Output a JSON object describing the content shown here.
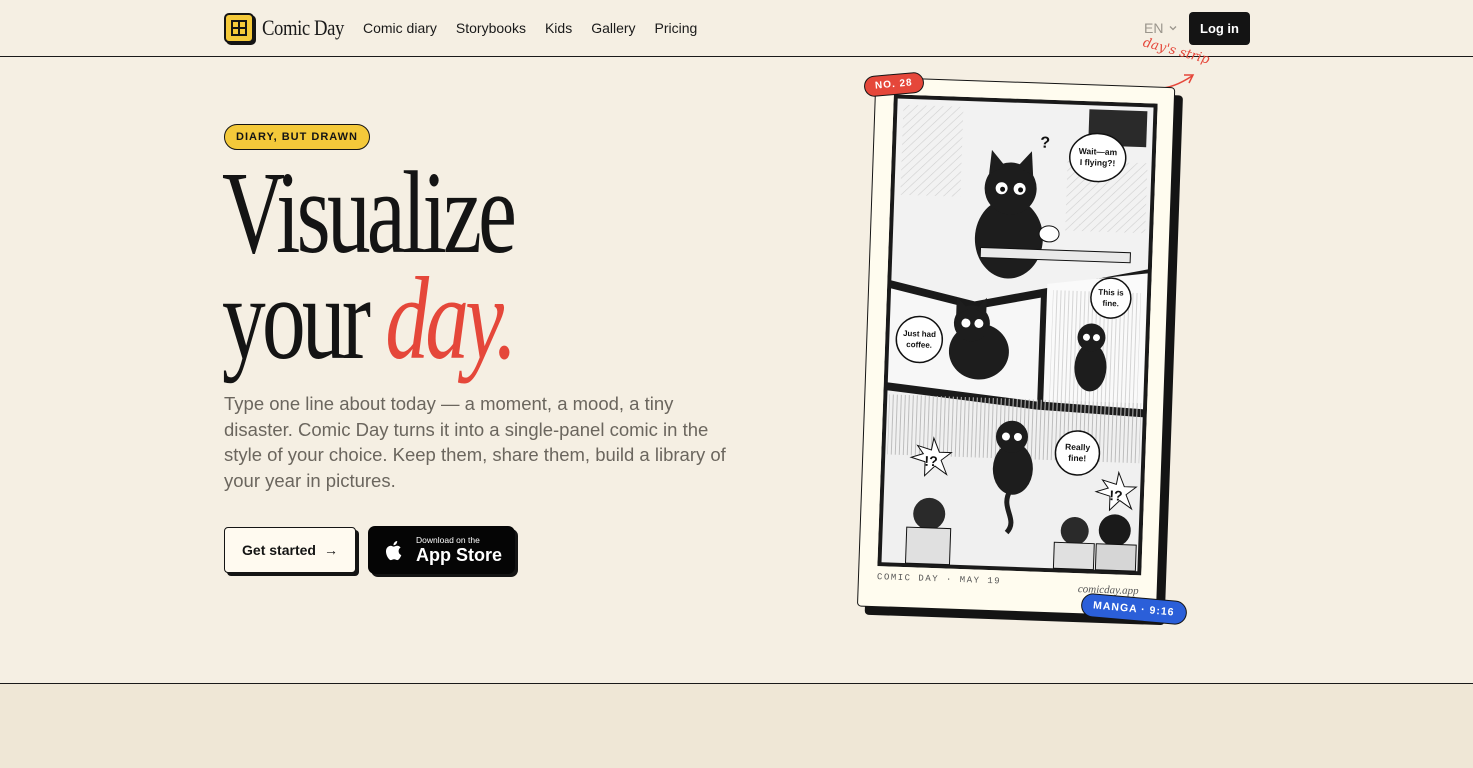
{
  "nav": {
    "brand": "Comic Day",
    "links": [
      "Comic diary",
      "Storybooks",
      "Kids",
      "Gallery",
      "Pricing"
    ],
    "language": "EN",
    "login_label": "Log in"
  },
  "hero": {
    "badge": "DIARY, BUT DRAWN",
    "title_line1": "Visualize",
    "title_line2_plain": "your",
    "title_line2_accent": "day.",
    "lede": "Type one line about today — a moment, a mood, a tiny disaster. Comic Day turns it into a single-panel comic in the style of your choice. Keep them, share them, build a library of your year in pictures.",
    "cta_primary": "Get started",
    "cta_primary_arrow": "→",
    "app_store_small": "Download on the",
    "app_store_big": "App Store"
  },
  "comic_card": {
    "number_tag": "NO. 28",
    "style_tag": "MANGA · 9:16",
    "footer_left": "COMIC DAY · MAY 19",
    "footer_right": "comicday.app",
    "scribble": "day's strip",
    "bubbles": [
      "Wait—am I flying?!",
      "This is fine.",
      "Just had coffee.",
      "Really fine!",
      "!?",
      "!?"
    ]
  },
  "colors": {
    "background": "#f5efe3",
    "ink": "#141414",
    "accent_red": "#e5473a",
    "accent_yellow": "#f4c93a",
    "accent_blue": "#2b5fd9"
  }
}
